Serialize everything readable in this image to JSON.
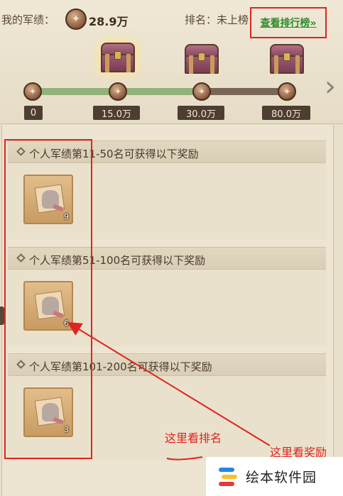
{
  "header": {
    "merit_label": "我的军绩：",
    "merit_value": "28.9万",
    "rank_label": "排名：未上榜",
    "rank_button": "查看排行榜»"
  },
  "progress": {
    "current": 28.9,
    "max": 80.0,
    "milestones": [
      "0",
      "15.0万",
      "30.0万",
      "80.0万"
    ]
  },
  "sections": [
    {
      "title": "个人军绩第11-50名可获得以下奖励",
      "qty": "9"
    },
    {
      "title": "个人军绩第51-100名可获得以下奖励",
      "qty": "6"
    },
    {
      "title": "个人军绩第101-200名可获得以下奖励",
      "qty": "3"
    }
  ],
  "annotations": {
    "rank_note": "这里看排名",
    "reward_note": "这里看奖励"
  },
  "watermark": {
    "text": "绘本软件园"
  },
  "colors": {
    "annotation_red": "#e0241f",
    "link_green": "#2f8b2a",
    "track_fill": "#93b27a"
  }
}
